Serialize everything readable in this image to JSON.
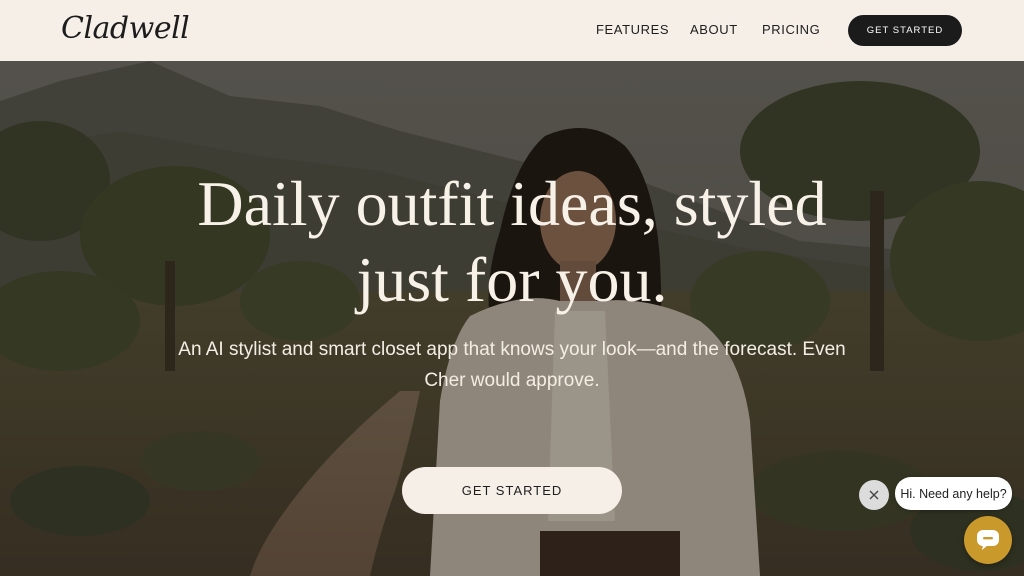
{
  "brand": {
    "logo_text": "Cladwell"
  },
  "nav": {
    "features": "FEATURES",
    "about": "ABOUT",
    "pricing": "PRICING",
    "cta": "GET STARTED"
  },
  "hero": {
    "title_line1": "Daily outfit ideas, styled",
    "title_line2": "just for you.",
    "subtitle_line1": "An AI stylist and smart closet app that knows your look—and the forecast. Even",
    "subtitle_line2": "Cher would approve.",
    "cta": "GET STARTED",
    "background_icon": "woman-in-field-photo"
  },
  "chat": {
    "greeting": "Hi. Need any help?",
    "close_icon": "close-icon",
    "launcher_icon": "chat-icon"
  },
  "colors": {
    "header_bg": "#f5efe8",
    "dark_button": "#1b1b1b",
    "chat_launcher": "#c9992c"
  }
}
